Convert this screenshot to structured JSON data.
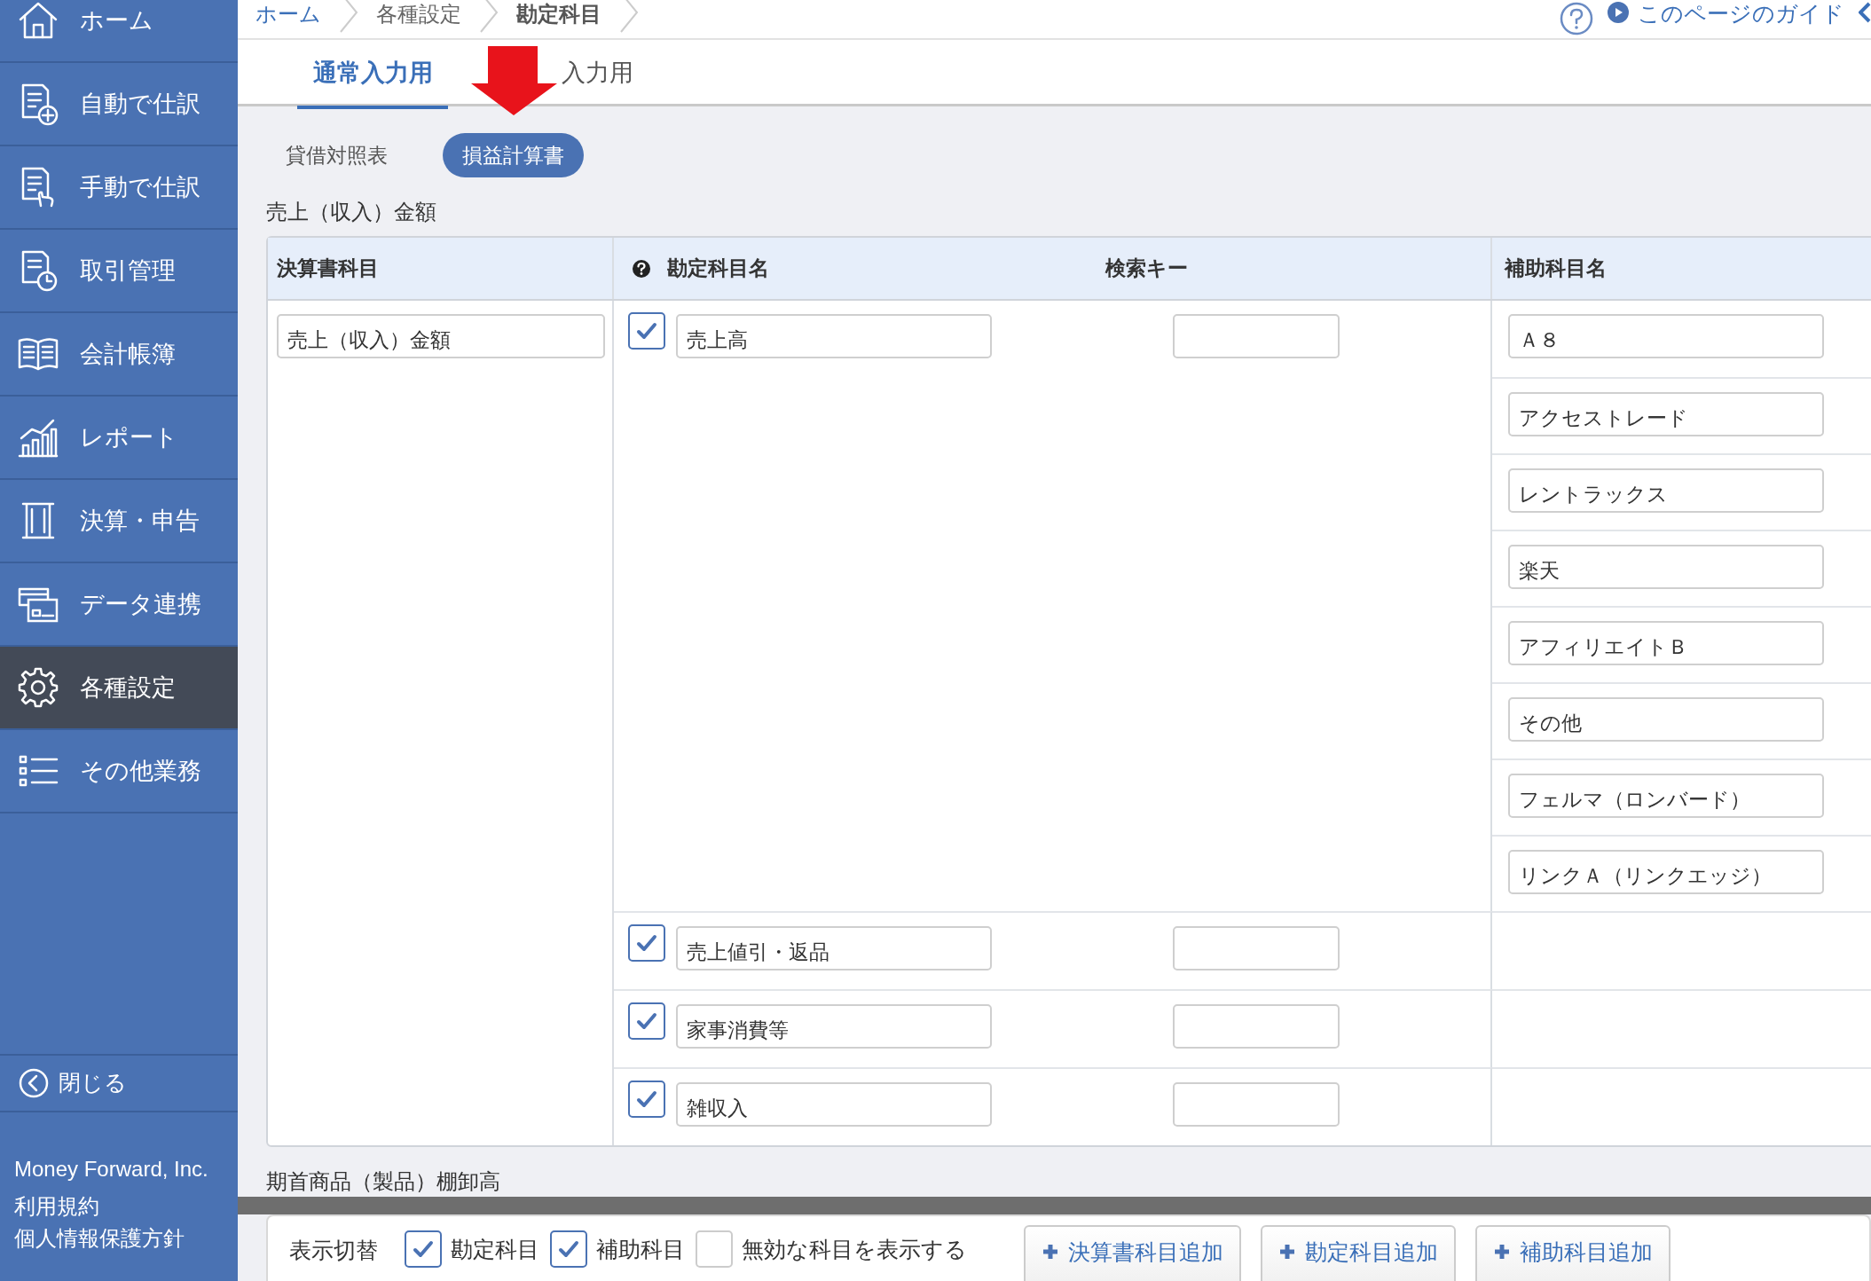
{
  "sidebar": {
    "items": [
      {
        "label": "ホーム",
        "selected": false
      },
      {
        "label": "自動で仕訳",
        "selected": false
      },
      {
        "label": "手動で仕訳",
        "selected": false
      },
      {
        "label": "取引管理",
        "selected": false
      },
      {
        "label": "会計帳簿",
        "selected": false
      },
      {
        "label": "レポート",
        "selected": false
      },
      {
        "label": "決算・申告",
        "selected": false
      },
      {
        "label": "データ連携",
        "selected": false
      },
      {
        "label": "各種設定",
        "selected": true
      },
      {
        "label": "その他業務",
        "selected": false
      }
    ],
    "close": "閉じる",
    "company": "Money Forward, Inc.",
    "links": [
      "利用規約",
      "個人情報保護方針"
    ]
  },
  "breadcrumb": [
    {
      "label": "ホーム",
      "kind": "link"
    },
    {
      "label": "各種設定",
      "kind": "plain"
    },
    {
      "label": "勘定科目",
      "kind": "current"
    }
  ],
  "guide_link": "このページのガイド",
  "tabs": [
    {
      "label": "通常入力用",
      "selected": true
    },
    {
      "label": "入力用",
      "selected": false
    }
  ],
  "statement_tabs": [
    {
      "label": "貸借対照表",
      "selected": false
    },
    {
      "label": "損益計算書",
      "selected": true
    }
  ],
  "sections": [
    {
      "title": "売上（収入）金額",
      "table": {
        "columns": [
          "決算書科目",
          "勘定科目名",
          "検索キー",
          "補助科目名"
        ],
        "statement_item": "売上（収入）金額",
        "accounts": [
          {
            "checked": true,
            "name": "売上高",
            "sub_accounts": [
              "Ａ８",
              "アクセストレード",
              "レントラックス",
              "楽天",
              "アフィリエイトＢ",
              "その他",
              "フェルマ（ロンバード）",
              "リンクＡ（リンクエッジ）"
            ]
          },
          {
            "checked": true,
            "name": "売上値引・返品"
          },
          {
            "checked": true,
            "name": "家事消費等"
          },
          {
            "checked": true,
            "name": "雑収入"
          }
        ]
      }
    },
    {
      "title": "期首商品（製品）棚卸高"
    }
  ],
  "footer": {
    "label": "表示切替",
    "toggles": [
      {
        "label": "勘定科目",
        "checked": true
      },
      {
        "label": "補助科目",
        "checked": true
      },
      {
        "label": "無効な科目を表示する",
        "checked": false
      }
    ],
    "buttons": [
      "決算書科目追加",
      "勘定科目追加",
      "補助科目追加"
    ]
  }
}
